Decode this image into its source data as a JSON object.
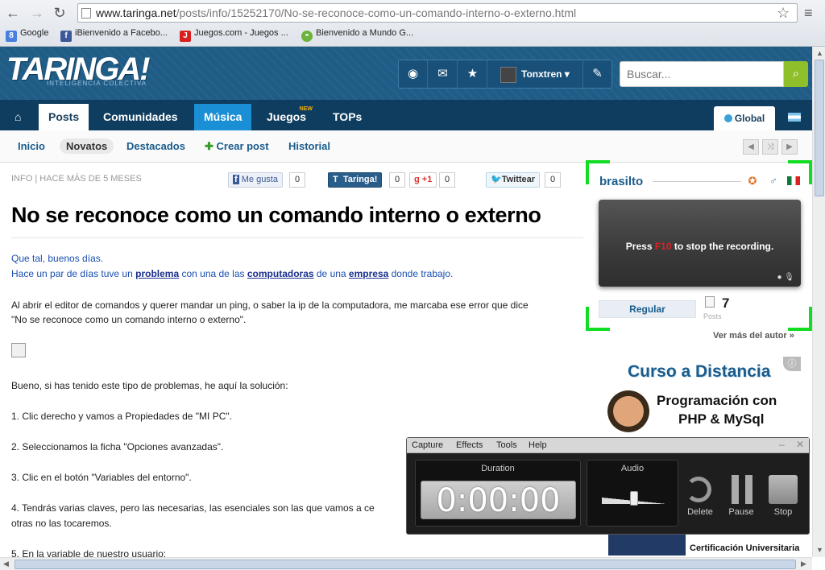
{
  "browser": {
    "url_host": "www.taringa.net",
    "url_path": "/posts/info/15252170/No-se-reconoce-como-un-comando-interno-o-externo.html",
    "bookmarks": [
      "Google",
      "iBienvenido a Facebo...",
      "Juegos.com - Juegos ...",
      "Bienvenido a Mundo G..."
    ]
  },
  "header": {
    "logo": "TARINGA!",
    "logo_sub": "INTELIGENCIA COLECTIVA",
    "username": "Tonxtren",
    "search_placeholder": "Buscar..."
  },
  "tabs": [
    "Posts",
    "Comunidades",
    "Música",
    "Juegos",
    "TOPs"
  ],
  "new_badge": "NEW",
  "global_tab": "Global",
  "subnav": [
    "Inicio",
    "Novatos",
    "Destacados",
    "Crear post",
    "Historial"
  ],
  "post": {
    "meta": "INFO | HACE MÁS DE 5 MESES",
    "like_label": "Me gusta",
    "like_count": "0",
    "taringa_label": "Taringa!",
    "taringa_count": "0",
    "gplus_label": "+1",
    "gplus_count": "0",
    "tweet_label": "Twittear",
    "tweet_count": "0",
    "title": "No se reconoce como un comando interno o externo",
    "p1": "Que tal, buenos días.",
    "p2a": "Hace un par de días tuve un ",
    "p2_link1": "problema",
    "p2b": " con una de las ",
    "p2_link2": "computadoras",
    "p2c": " de una ",
    "p2_link3": "empresa",
    "p2d": " donde trabajo.",
    "p3": "Al abrir el editor de comandos y querer mandar un ping, o saber la ip de la computadora, me marcaba ese error que dice",
    "p4": "\"No se reconoce como un comando interno o externo\".",
    "p5": "Bueno, si has tenido este tipo de problemas, he aquí la solución:",
    "p6": "1. Clic derecho y vamos a Propiedades de \"MI PC\".",
    "p7": "2. Seleccionamos la ficha \"Opciones avanzadas\".",
    "p8": "3. Clic en el botón \"Variables del entorno\".",
    "p9": "4. Tendrás varias claves, pero las necesarias, las esenciales son las que vamos a ce",
    "p10": "otras no las tocaremos.",
    "p11": "5. En la variable de nuestro usuario:"
  },
  "sidebar": {
    "author": "brasilto",
    "recording_pre": "Press ",
    "recording_key": "F10",
    "recording_post": " to stop the recording.",
    "rank": "Regular",
    "posts_count": "7",
    "posts_label": "Posts",
    "see_more": "Ver más del autor »",
    "ad_title": "Curso a Distancia",
    "ad_line1": "Programación con",
    "ad_line2": "PHP & MySql",
    "ad_footer": "Certificación Universitaria"
  },
  "recorder": {
    "menu": [
      "Capture",
      "Effects",
      "Tools",
      "Help"
    ],
    "duration_label": "Duration",
    "time": "0:00:00",
    "audio_label": "Audio",
    "audio_level": 0.5,
    "delete_label": "Delete",
    "pause_label": "Pause",
    "stop_label": "Stop"
  }
}
